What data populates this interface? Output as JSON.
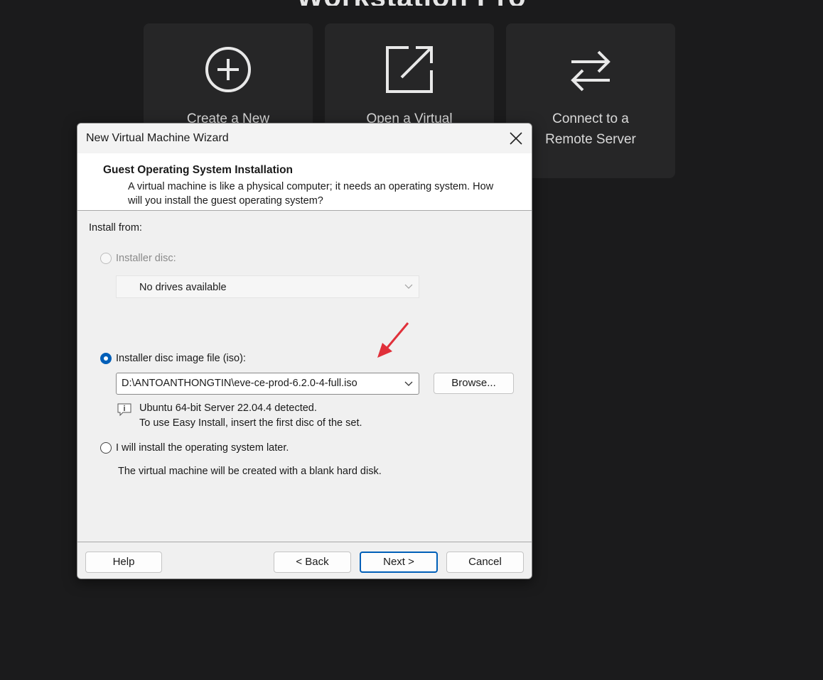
{
  "background": {
    "heading_partial": "Workstation Pro"
  },
  "tiles": [
    {
      "label": "Create a New",
      "icon": "plus-circle-icon"
    },
    {
      "label": "Open a Virtual",
      "icon": "open-external-icon"
    },
    {
      "label": "Connect to a\nRemote Server",
      "icon": "swap-arrows-icon"
    }
  ],
  "dialog": {
    "title": "New Virtual Machine Wizard",
    "header_title": "Guest Operating System Installation",
    "header_description": "A virtual machine is like a physical computer; it needs an operating system. How will you install the guest operating system?",
    "install_from_label": "Install from:",
    "options": {
      "installer_disc": {
        "label": "Installer disc:",
        "selected": false,
        "enabled": false,
        "drive_value": "No drives available"
      },
      "iso": {
        "label": "Installer disc image file (iso):",
        "selected": true,
        "path_value": "D:\\ANTOANTHONGTIN\\eve-ce-prod-6.2.0-4-full.iso",
        "browse_label": "Browse...",
        "detected_line1": "Ubuntu 64-bit Server 22.04.4 detected.",
        "detected_line2": "To use Easy Install, insert the first disc of the set."
      },
      "later": {
        "label": "I will install the operating system later.",
        "selected": false,
        "note": "The virtual machine will be created with a blank hard disk."
      }
    },
    "buttons": {
      "help": "Help",
      "back": "< Back",
      "next": "Next >",
      "cancel": "Cancel"
    }
  },
  "annotation": {
    "arrow_color": "#e0303a"
  },
  "colors": {
    "accent": "#005fb8",
    "app_background": "#1b1b1c",
    "tile_background": "#262627"
  }
}
